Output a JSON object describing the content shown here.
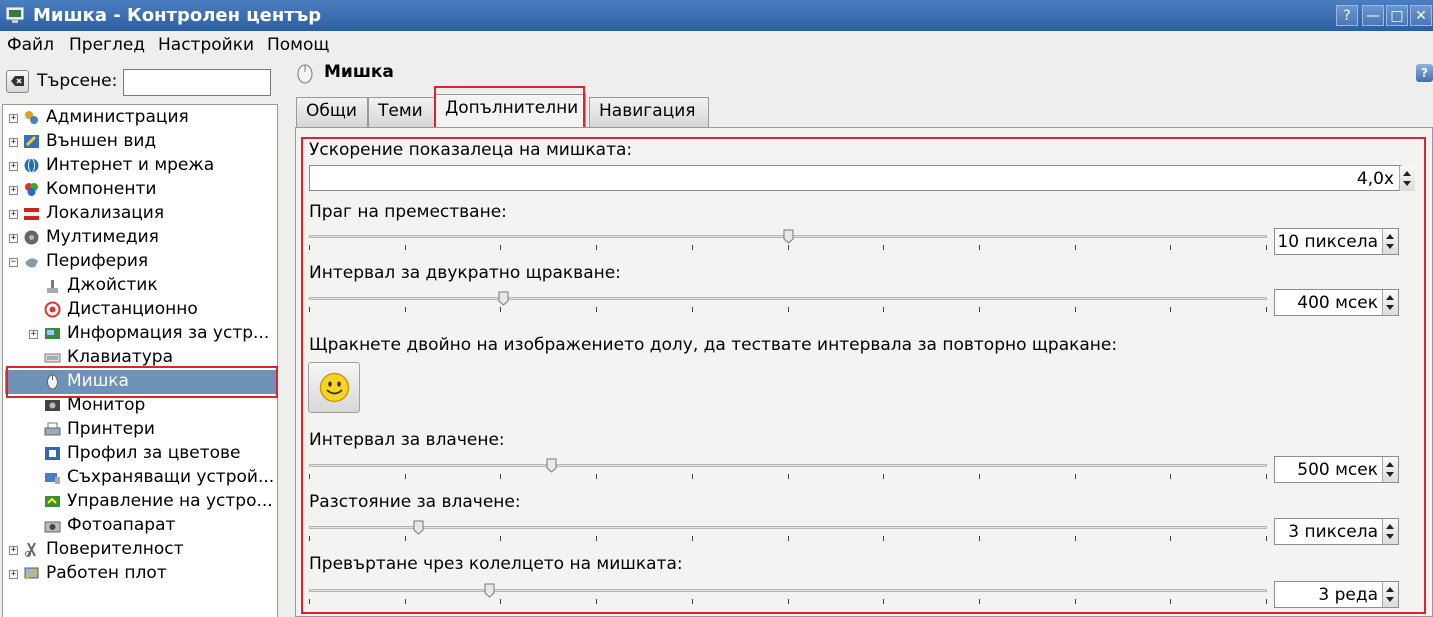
{
  "window": {
    "title": "Мишка - Контролен център",
    "help_btn": "?",
    "min_btn": "—",
    "max_btn": "□",
    "close_btn": "✕"
  },
  "menu": {
    "file": "Файл",
    "view": "Преглед",
    "settings": "Настройки",
    "help": "Помощ"
  },
  "search": {
    "label": "Търсене:",
    "value": ""
  },
  "tree": {
    "items": [
      {
        "label": "Администрация",
        "icon": "administration-icon"
      },
      {
        "label": "Външен вид",
        "icon": "appearance-icon"
      },
      {
        "label": "Интернет и мрежа",
        "icon": "network-icon"
      },
      {
        "label": "Компоненти",
        "icon": "components-icon"
      },
      {
        "label": "Локализация",
        "icon": "localization-icon"
      },
      {
        "label": "Мултимедия",
        "icon": "multimedia-icon"
      },
      {
        "label": "Периферия",
        "icon": "peripherals-icon"
      },
      {
        "label": "Джойстик",
        "icon": "joystick-icon"
      },
      {
        "label": "Дистанционно",
        "icon": "remote-icon"
      },
      {
        "label": "Информация за устр...",
        "icon": "device-info-icon"
      },
      {
        "label": "Клавиатура",
        "icon": "keyboard-icon"
      },
      {
        "label": "Мишка",
        "icon": "mouse-icon"
      },
      {
        "label": "Монитор",
        "icon": "monitor-icon"
      },
      {
        "label": "Принтери",
        "icon": "printer-icon"
      },
      {
        "label": "Профил за цветове",
        "icon": "color-profile-icon"
      },
      {
        "label": "Съхраняващи устрой...",
        "icon": "storage-icon"
      },
      {
        "label": "Управление на устро...",
        "icon": "device-manager-icon"
      },
      {
        "label": "Фотоапарат",
        "icon": "camera-icon"
      },
      {
        "label": "Поверителност",
        "icon": "privacy-icon"
      },
      {
        "label": "Работен плот",
        "icon": "desktop-icon"
      }
    ]
  },
  "page": {
    "title": "Мишка"
  },
  "tabs": [
    {
      "label": "Общи"
    },
    {
      "label": "Теми"
    },
    {
      "label": "Допълнителни"
    },
    {
      "label": "Навигация"
    }
  ],
  "advanced": {
    "acceleration_label": "Ускорение показалеца на мишката:",
    "acceleration_value": "4,0x",
    "threshold_label": "Праг на преместване:",
    "threshold_value": "10 пиксела",
    "threshold_level": 0.5,
    "dblclick_label": "Интервал за двукратно щракване:",
    "dblclick_value": "400 мсек",
    "dblclick_level": 0.2,
    "test_label": "Щракнете двойно на изображението долу, да тествате интервала за повторно щракане:",
    "drag_time_label": "Интервал за влачене:",
    "drag_time_value": "500 мсек",
    "drag_time_level": 0.25,
    "drag_dist_label": "Разстояние за влачене:",
    "drag_dist_value": "3 пиксела",
    "drag_dist_level": 0.11,
    "wheel_label": "Превъртане чрез колелцето на мишката:",
    "wheel_value": "3 реда",
    "wheel_level": 0.185
  },
  "colors": {
    "selection": "#6e91b8",
    "highlight_box": "#d9262c",
    "titlebar": "#3b6db0"
  }
}
